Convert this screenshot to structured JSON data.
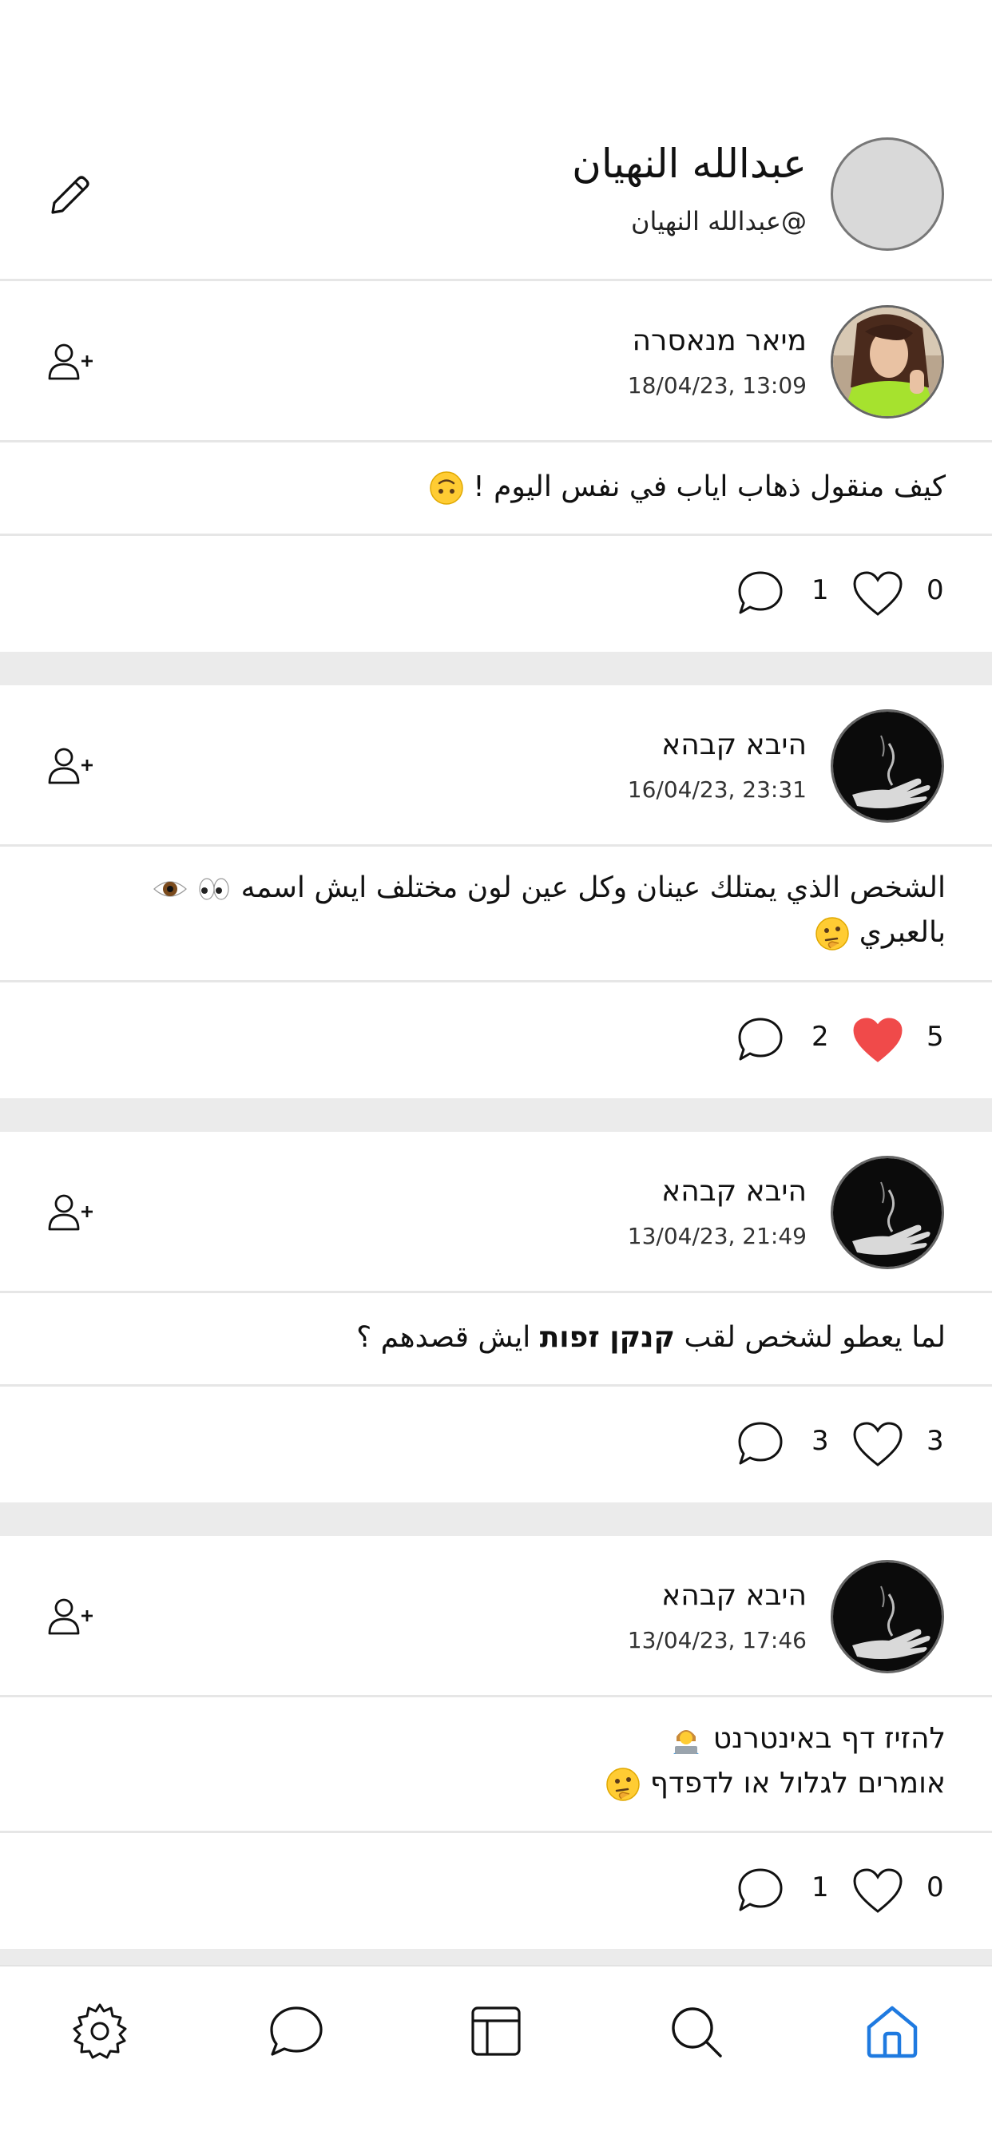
{
  "profile": {
    "name": "عبدالله النهيان",
    "handle": "@عبدالله النهيان"
  },
  "posts": [
    {
      "author": "מיאר מנאסרה",
      "time": "18/04/23, 13:09",
      "text_lines": [
        "كيف منقول ذهاب اياب في نفس اليوم !"
      ],
      "likes": "0",
      "comments": "1",
      "liked": false,
      "avatar": "photo-woman-green"
    },
    {
      "author": "היבא קבהא",
      "time": "16/04/23, 23:31",
      "text_lines": [
        "الشخص الذي يمتلك عينان وكل عين لون مختلف ايش اسمه",
        "بالعبري"
      ],
      "likes": "5",
      "comments": "2",
      "liked": true,
      "avatar": "photo-hand-dark"
    },
    {
      "author": "היבא קבהא",
      "time": "13/04/23, 21:49",
      "text_lines": [
        "لما يعطو لشخص لقب",
        "קנקן זפות",
        "ايش قصدهم ؟"
      ],
      "likes": "3",
      "comments": "3",
      "liked": false,
      "avatar": "photo-hand-dark"
    },
    {
      "author": "היבא קבהא",
      "time": "13/04/23, 17:46",
      "text_lines": [
        "להזיז דף באינטרנט",
        "אומרים לגלול או לדפדף"
      ],
      "likes": "0",
      "comments": "1",
      "liked": false,
      "avatar": "photo-hand-dark"
    }
  ],
  "tabbar": {
    "items": [
      "gear-icon",
      "chat-icon",
      "layout-icon",
      "search-icon",
      "home-icon"
    ],
    "active": "home-icon",
    "active_color": "#1f7ae0"
  },
  "colors": {
    "heart_liked": "#f04a4a",
    "separator": "#ebebeb"
  }
}
